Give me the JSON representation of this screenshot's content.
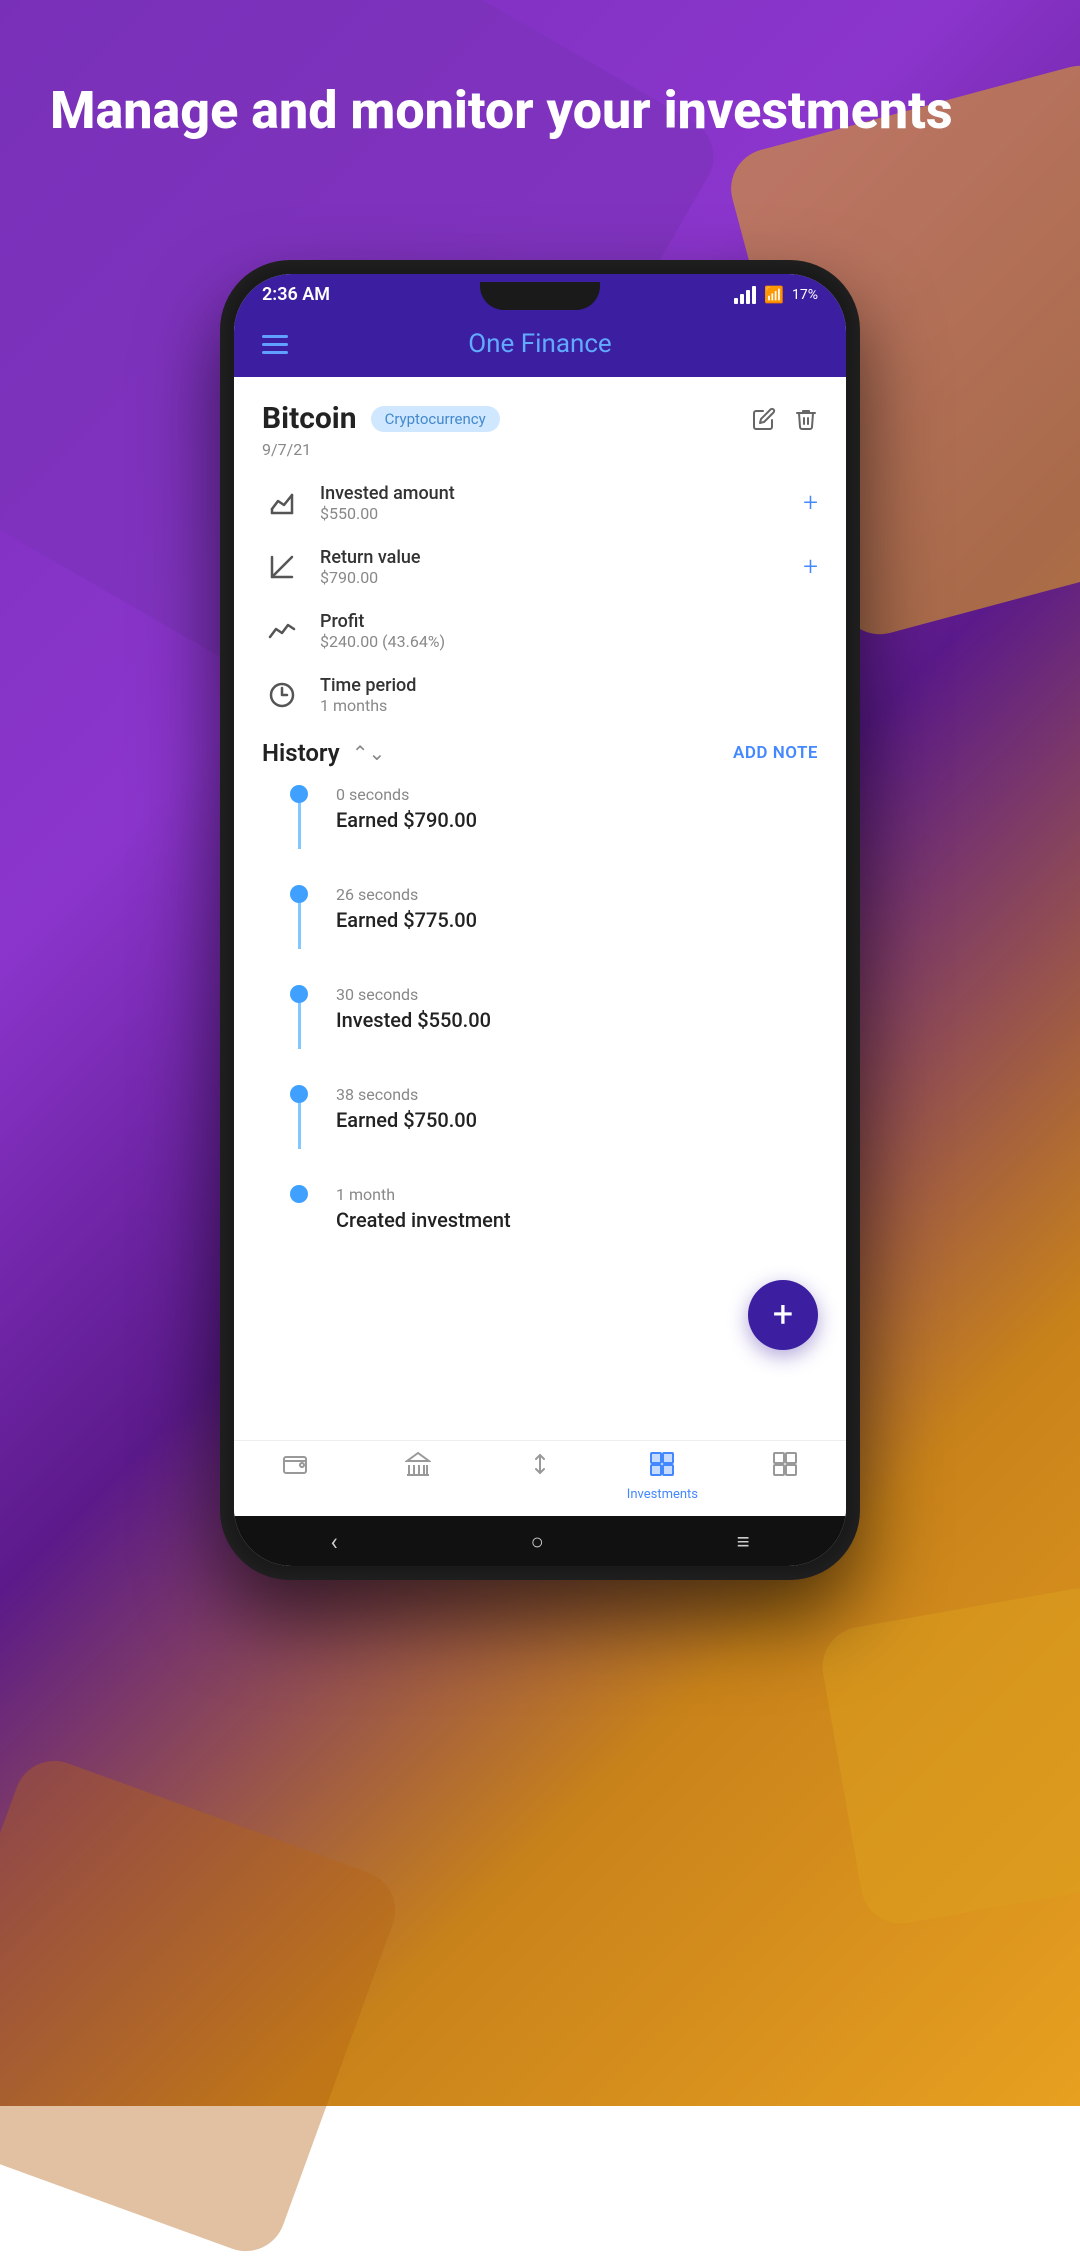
{
  "background": {
    "headline": "Manage and monitor your investments"
  },
  "status_bar": {
    "time": "2:36 AM",
    "battery": "17%"
  },
  "app_bar": {
    "title": "One Finance"
  },
  "investment": {
    "name": "Bitcoin",
    "category": "Cryptocurrency",
    "date": "9/7/21",
    "edit_label": "✏",
    "delete_label": "🗑"
  },
  "stats": [
    {
      "id": "invested",
      "label": "Invested amount",
      "value": "$550.00",
      "has_add": true
    },
    {
      "id": "return",
      "label": "Return value",
      "value": "$790.00",
      "has_add": true
    },
    {
      "id": "profit",
      "label": "Profit",
      "value": "$240.00 (43.64%)",
      "has_add": false
    },
    {
      "id": "time",
      "label": "Time period",
      "value": "1 months",
      "has_add": false
    }
  ],
  "history": {
    "title": "History",
    "add_note_label": "ADD NOTE",
    "items": [
      {
        "time": "0 seconds",
        "action": "Earned $790.00"
      },
      {
        "time": "26 seconds",
        "action": "Earned $775.00"
      },
      {
        "time": "30 seconds",
        "action": "Invested $550.00"
      },
      {
        "time": "38 seconds",
        "action": "Earned $750.00"
      },
      {
        "time": "1 month",
        "action": "Created investment"
      }
    ]
  },
  "fab": {
    "label": "+"
  },
  "bottom_nav": {
    "items": [
      {
        "id": "wallet",
        "label": "",
        "active": false,
        "icon": "wallet"
      },
      {
        "id": "bank",
        "label": "",
        "active": false,
        "icon": "bank"
      },
      {
        "id": "transfer",
        "label": "",
        "active": false,
        "icon": "transfer"
      },
      {
        "id": "investments",
        "label": "Investments",
        "active": true,
        "icon": "grid"
      },
      {
        "id": "dashboard",
        "label": "",
        "active": false,
        "icon": "dashboard"
      }
    ]
  },
  "android_nav": {
    "back": "‹",
    "home": "○",
    "menu": "≡"
  }
}
